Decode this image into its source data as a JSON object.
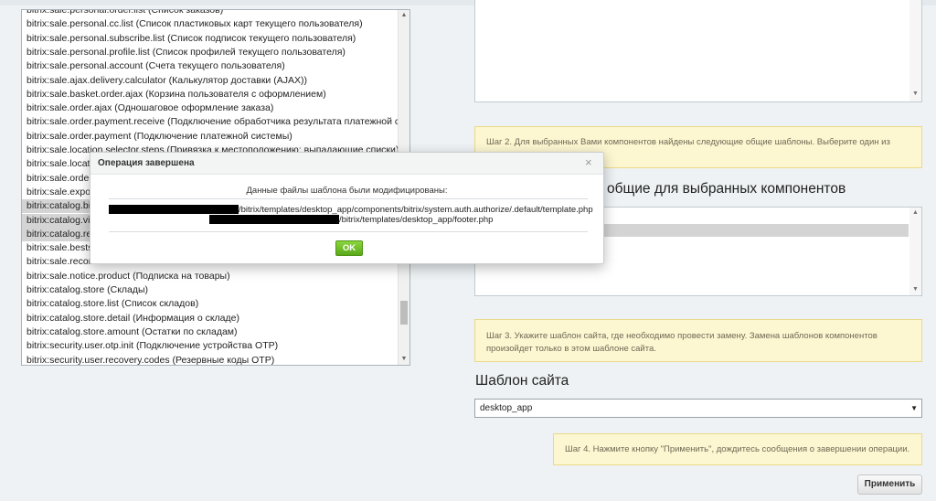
{
  "component_list": {
    "items": [
      {
        "text": "bitrix:sale.personal.order.list (Список заказов)",
        "selected": false
      },
      {
        "text": "bitrix:sale.personal.cc.list (Список пластиковых карт текущего пользователя)",
        "selected": false
      },
      {
        "text": "bitrix:sale.personal.subscribe.list (Список подписок текущего пользователя)",
        "selected": false
      },
      {
        "text": "bitrix:sale.personal.profile.list (Список профилей текущего пользователя)",
        "selected": false
      },
      {
        "text": "bitrix:sale.personal.account (Счета текущего пользователя)",
        "selected": false
      },
      {
        "text": "bitrix:sale.ajax.delivery.calculator (Калькулятор доставки (AJAX))",
        "selected": false
      },
      {
        "text": "bitrix:sale.basket.order.ajax (Корзина пользователя с оформлением)",
        "selected": false
      },
      {
        "text": "bitrix:sale.order.ajax (Одношаговое оформление заказа)",
        "selected": false
      },
      {
        "text": "bitrix:sale.order.payment.receive (Подключение обработчика результата платежной системы)",
        "selected": false
      },
      {
        "text": "bitrix:sale.order.payment (Подключение платежной системы)",
        "selected": false
      },
      {
        "text": "bitrix:sale.location.selector.steps (Привязка к местоположению: выпадающие списки)",
        "selected": false
      },
      {
        "text": "bitrix:sale.location",
        "selected": false
      },
      {
        "text": "bitrix:sale.order.fu",
        "selected": false
      },
      {
        "text": "bitrix:sale.export.",
        "selected": false
      },
      {
        "text": "bitrix:catalog.bigd",
        "selected": true
      },
      {
        "text": "bitrix:catalog.view",
        "selected": true
      },
      {
        "text": "bitrix:catalog.reco",
        "selected": true
      },
      {
        "text": "bitrix:sale.bestsel",
        "selected": false
      },
      {
        "text": "bitrix:sale.recomm",
        "selected": false
      },
      {
        "text": "bitrix:sale.notice.product (Подписка на товары)",
        "selected": false
      },
      {
        "text": "bitrix:catalog.store (Склады)",
        "selected": false
      },
      {
        "text": "bitrix:catalog.store.list (Список складов)",
        "selected": false
      },
      {
        "text": "bitrix:catalog.store.detail (Информация о складе)",
        "selected": false
      },
      {
        "text": "bitrix:catalog.store.amount (Остатки по складам)",
        "selected": false
      },
      {
        "text": "bitrix:security.user.otp.init (Подключение устройства OTP)",
        "selected": false
      },
      {
        "text": "bitrix:security.user.recovery.codes (Резервные коды OTP)",
        "selected": false
      }
    ]
  },
  "steps": {
    "step2": "Шаг 2. Для выбранных Вами компонентов найдены следующие общие шаблоны. Выберите один из",
    "step3": "Шаг 3. Укажите шаблон сайта, где необходимо провести замену. Замена шаблонов компонентов произойдет только в этом шаблоне сайта.",
    "step4": "Шаг 4. Нажмите кнопку \"Применить\", дождитесь сообщения о завершении операции."
  },
  "section_heading": "общие для выбранных компонентов",
  "site_template": {
    "title": "Шаблон сайта",
    "selected": "desktop_app"
  },
  "apply_label": "Применить",
  "dialog": {
    "title": "Операция завершена",
    "close": "×",
    "message": "Данные файлы шаблона были модифицированы:",
    "files": [
      "/bitrix/templates/desktop_app/components/bitrix/system.auth.authorize/.default/template.php",
      "/bitrix/templates/desktop_app/footer.php"
    ],
    "ok_label": "OK"
  },
  "colors": {
    "note_bg": "#fcf6d1",
    "ok_green": "#6cbd28",
    "selection": "#d4d4d4"
  }
}
